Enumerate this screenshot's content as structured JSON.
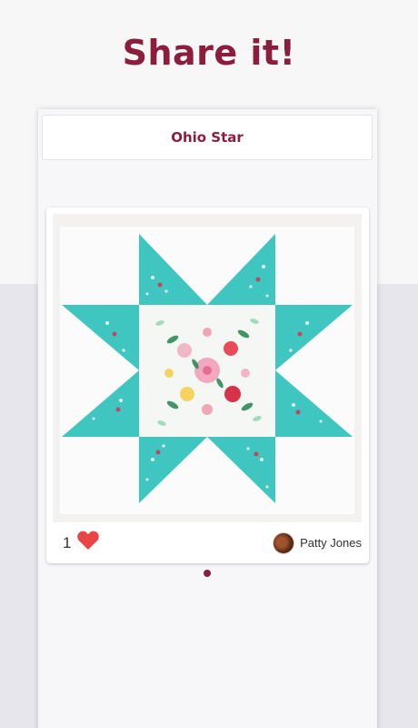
{
  "headline": "Share it!",
  "app": {
    "title": "Ohio Star"
  },
  "post": {
    "image_description": "quilt block photo",
    "like_count": "1",
    "author_name": "Patty Jones",
    "icons": {
      "like": "heart-icon",
      "avatar": "avatar"
    }
  },
  "colors": {
    "brand": "#8a1e3c",
    "heart": "#e94545",
    "quilt_teal": "#3fc6c1"
  }
}
